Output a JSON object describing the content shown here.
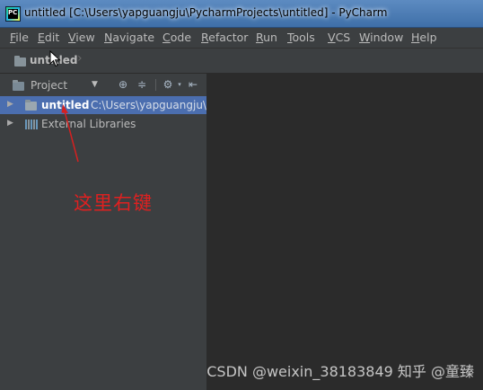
{
  "window": {
    "title": "untitled [C:\\Users\\yapguangju\\PycharmProjects\\untitled] - PyCharm"
  },
  "menu": {
    "items": [
      "File",
      "Edit",
      "View",
      "Navigate",
      "Code",
      "Refactor",
      "Run",
      "Tools",
      "VCS",
      "Window",
      "Help"
    ]
  },
  "navbar": {
    "breadcrumb": "untitled"
  },
  "project_panel": {
    "view_label": "Project",
    "tree": [
      {
        "label": "untitled",
        "path": "C:\\Users\\yapguangju\\",
        "icon": "folder-icon",
        "selected": true
      },
      {
        "label": "External Libraries",
        "icon": "library-icon",
        "selected": false
      }
    ]
  },
  "annotation": {
    "text": "这里右键",
    "color": "#e02020"
  },
  "watermark": {
    "text": "CSDN @weixin_38183849 知乎 @童臻"
  },
  "colors": {
    "selection": "#4b6eaf",
    "panel_bg": "#3c3f41",
    "editor_bg": "#2b2b2b"
  }
}
